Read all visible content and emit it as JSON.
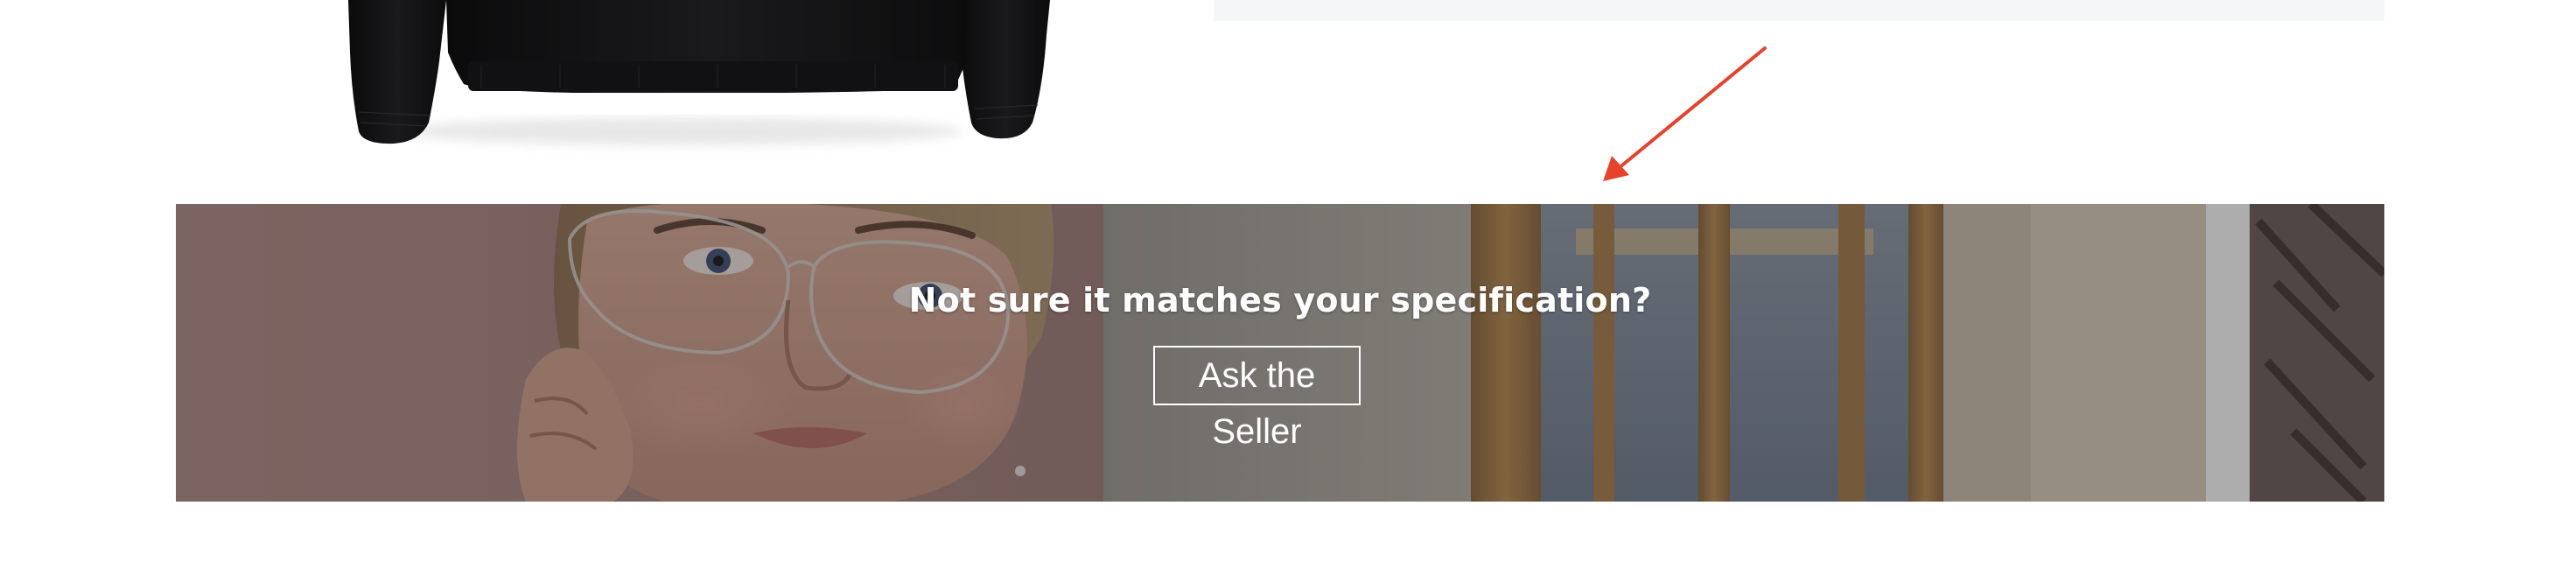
{
  "product": {
    "image_icon": "black-sweatshirt-photo"
  },
  "annotation": {
    "icon": "red-arrow-icon",
    "color": "#e8412c"
  },
  "banner": {
    "headline": "Not sure it matches your specification?",
    "button_label": "Ask the Seller",
    "photo_icon": "woman-with-glasses-photo",
    "text_color": "#ffffff"
  }
}
